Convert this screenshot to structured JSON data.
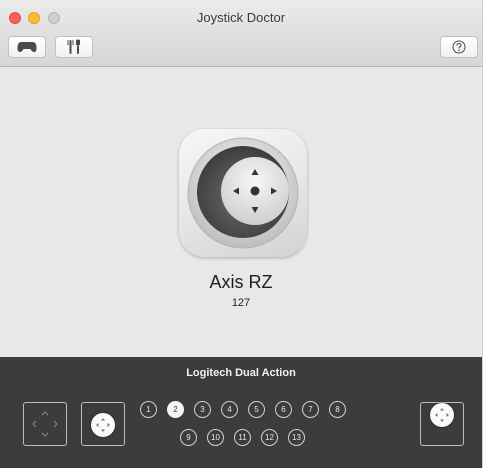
{
  "window": {
    "title": "Joystick Doctor"
  },
  "toolbar": {
    "items": [
      {
        "icon": "gamepad-icon"
      },
      {
        "icon": "tools-icon"
      },
      {
        "icon": "help-icon"
      }
    ]
  },
  "axis": {
    "name": "Axis RZ",
    "value": "127"
  },
  "device": {
    "name": "Logitech Dual Action",
    "buttons_row1": [
      "1",
      "2",
      "3",
      "4",
      "5",
      "6",
      "7",
      "8"
    ],
    "buttons_row2": [
      "9",
      "10",
      "11",
      "12",
      "13"
    ],
    "active_button": "2"
  },
  "colors": {
    "close": "#fc5f57",
    "minimize": "#fdbc2e",
    "zoom": "#cfcfcf",
    "footer_bg": "#3c3c3c",
    "window_bg": "#e8e8e8"
  }
}
